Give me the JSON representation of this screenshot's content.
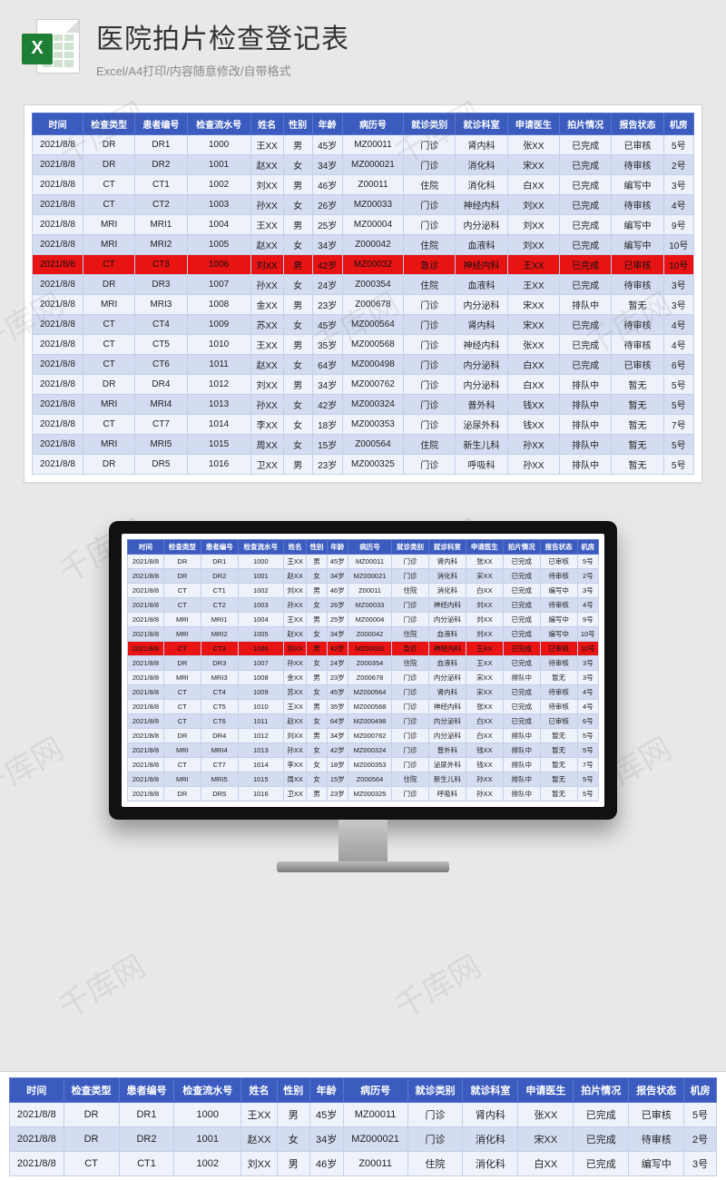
{
  "header": {
    "title": "医院拍片检查登记表",
    "subtitle": "Excel/A4打印/内容随意修改/自带格式",
    "icon_letter": "X"
  },
  "watermark_text": "千库网",
  "columns": [
    "时间",
    "检查类型",
    "患者编号",
    "检查流水号",
    "姓名",
    "性别",
    "年龄",
    "病历号",
    "就诊类别",
    "就诊科室",
    "申请医生",
    "拍片情况",
    "报告状态",
    "机房"
  ],
  "highlight_row_index": 6,
  "rows": [
    [
      "2021/8/8",
      "DR",
      "DR1",
      "1000",
      "王XX",
      "男",
      "45岁",
      "MZ00011",
      "门诊",
      "肾内科",
      "张XX",
      "已完成",
      "已审核",
      "5号"
    ],
    [
      "2021/8/8",
      "DR",
      "DR2",
      "1001",
      "赵XX",
      "女",
      "34岁",
      "MZ000021",
      "门诊",
      "消化科",
      "宋XX",
      "已完成",
      "待审核",
      "2号"
    ],
    [
      "2021/8/8",
      "CT",
      "CT1",
      "1002",
      "刘XX",
      "男",
      "46岁",
      "Z00011",
      "住院",
      "消化科",
      "白XX",
      "已完成",
      "编写中",
      "3号"
    ],
    [
      "2021/8/8",
      "CT",
      "CT2",
      "1003",
      "孙XX",
      "女",
      "26岁",
      "MZ00033",
      "门诊",
      "神经内科",
      "刘XX",
      "已完成",
      "待审核",
      "4号"
    ],
    [
      "2021/8/8",
      "MRI",
      "MRI1",
      "1004",
      "王XX",
      "男",
      "25岁",
      "MZ00004",
      "门诊",
      "内分泌科",
      "刘XX",
      "已完成",
      "编写中",
      "9号"
    ],
    [
      "2021/8/8",
      "MRI",
      "MRI2",
      "1005",
      "赵XX",
      "女",
      "34岁",
      "Z000042",
      "住院",
      "血液科",
      "刘XX",
      "已完成",
      "编写中",
      "10号"
    ],
    [
      "2021/8/8",
      "CT",
      "CT3",
      "1006",
      "刘XX",
      "男",
      "42岁",
      "MZ00032",
      "急诊",
      "神经内科",
      "王XX",
      "已完成",
      "已审核",
      "10号"
    ],
    [
      "2021/8/8",
      "DR",
      "DR3",
      "1007",
      "孙XX",
      "女",
      "24岁",
      "Z000354",
      "住院",
      "血液科",
      "王XX",
      "已完成",
      "待审核",
      "3号"
    ],
    [
      "2021/8/8",
      "MRI",
      "MRI3",
      "1008",
      "金XX",
      "男",
      "23岁",
      "Z000678",
      "门诊",
      "内分泌科",
      "宋XX",
      "排队中",
      "暂无",
      "3号"
    ],
    [
      "2021/8/8",
      "CT",
      "CT4",
      "1009",
      "苏XX",
      "女",
      "45岁",
      "MZ000564",
      "门诊",
      "肾内科",
      "宋XX",
      "已完成",
      "待审核",
      "4号"
    ],
    [
      "2021/8/8",
      "CT",
      "CT5",
      "1010",
      "王XX",
      "男",
      "35岁",
      "MZ000568",
      "门诊",
      "神经内科",
      "张XX",
      "已完成",
      "待审核",
      "4号"
    ],
    [
      "2021/8/8",
      "CT",
      "CT6",
      "1011",
      "赵XX",
      "女",
      "64岁",
      "MZ000498",
      "门诊",
      "内分泌科",
      "白XX",
      "已完成",
      "已审核",
      "6号"
    ],
    [
      "2021/8/8",
      "DR",
      "DR4",
      "1012",
      "刘XX",
      "男",
      "34岁",
      "MZ000762",
      "门诊",
      "内分泌科",
      "白XX",
      "排队中",
      "暂无",
      "5号"
    ],
    [
      "2021/8/8",
      "MRI",
      "MRI4",
      "1013",
      "孙XX",
      "女",
      "42岁",
      "MZ000324",
      "门诊",
      "普外科",
      "钱XX",
      "排队中",
      "暂无",
      "5号"
    ],
    [
      "2021/8/8",
      "CT",
      "CT7",
      "1014",
      "李XX",
      "女",
      "18岁",
      "MZ000353",
      "门诊",
      "泌尿外科",
      "钱XX",
      "排队中",
      "暂无",
      "7号"
    ],
    [
      "2021/8/8",
      "MRI",
      "MRI5",
      "1015",
      "周XX",
      "女",
      "15岁",
      "Z000564",
      "住院",
      "新生儿科",
      "孙XX",
      "排队中",
      "暂无",
      "5号"
    ],
    [
      "2021/8/8",
      "DR",
      "DR5",
      "1016",
      "卫XX",
      "男",
      "23岁",
      "MZ000325",
      "门诊",
      "呼吸科",
      "孙XX",
      "排队中",
      "暂无",
      "5号"
    ]
  ],
  "strip_row_count": 3
}
